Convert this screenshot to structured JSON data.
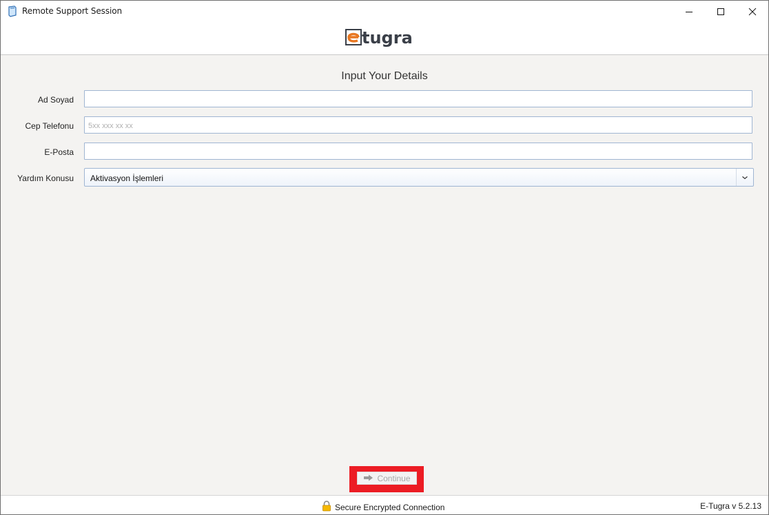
{
  "window": {
    "title": "Remote Support Session",
    "icon": "app-document-icon"
  },
  "header": {
    "logo_text": "etugra",
    "logo_colors": {
      "accent": "#e87722",
      "dark": "#3a3f48"
    }
  },
  "form": {
    "title": "Input Your Details",
    "fields": {
      "name": {
        "label": "Ad Soyad",
        "value": "",
        "placeholder": ""
      },
      "phone": {
        "label": "Cep Telefonu",
        "value": "",
        "placeholder": "5xx xxx xx xx"
      },
      "email": {
        "label": "E-Posta",
        "value": "",
        "placeholder": ""
      },
      "topic": {
        "label": "Yardım Konusu",
        "selected": "Aktivasyon İşlemleri"
      }
    },
    "continue_label": "Continue"
  },
  "status": {
    "secure_text": "Secure Encrypted Connection",
    "version": "E-Tugra v 5.2.13"
  },
  "colors": {
    "highlight": "#ec1c24",
    "field_border": "#9fb5d2"
  }
}
